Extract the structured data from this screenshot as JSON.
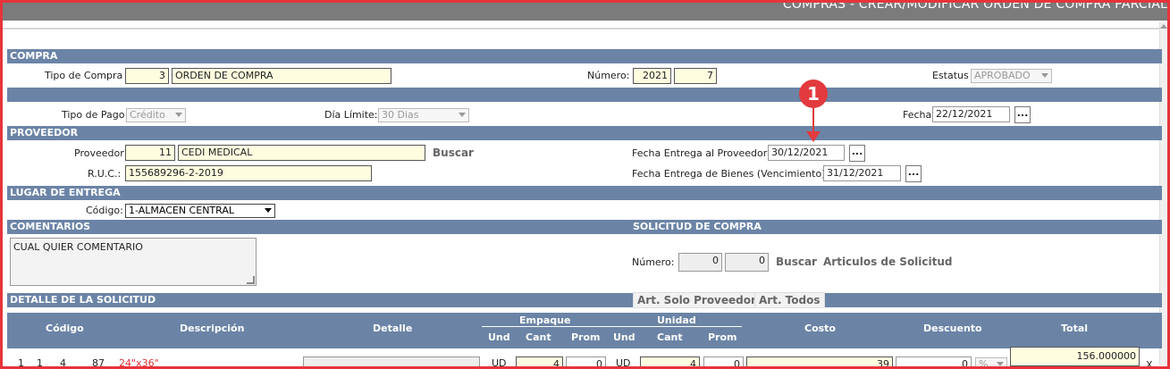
{
  "window": {
    "title": "COMPRAS - CREAR/MODIFICAR ORDEN DE COMPRA PARCIAL"
  },
  "compra": {
    "section": "COMPRA",
    "tipo_label": "Tipo de Compra",
    "tipo_code": "3",
    "tipo_name": "ORDEN DE COMPRA",
    "numero_label": "Número:",
    "numero_year": "2021",
    "numero_seq": "7",
    "estatus_label": "Estatus",
    "estatus_value": "APROBADO"
  },
  "pago": {
    "tipo_pago_label": "Tipo de Pago",
    "tipo_pago_value": "Crédito",
    "dia_limite_label": "Día Límite:",
    "dia_limite_value": "30 Dias",
    "fecha_label": "Fecha",
    "fecha_value": "22/12/2021",
    "dots": "..."
  },
  "proveedor": {
    "section": "PROVEEDOR",
    "proveedor_label": "Proveedor",
    "code": "11",
    "name": "CEDI MEDICAL",
    "buscar": "Buscar",
    "ruc_label": "R.U.C.:",
    "ruc_value": "155689296-2-2019",
    "fecha_entrega_label": "Fecha Entrega al Proveedor",
    "fecha_entrega_value": "30/12/2021",
    "fecha_bienes_label": "Fecha Entrega de Bienes (Vencimiento)",
    "fecha_bienes_value": "31/12/2021",
    "dots": "..."
  },
  "lugar": {
    "section": "LUGAR DE ENTREGA",
    "codigo_label": "Código:",
    "codigo_value": "1-ALMACEN CENTRAL"
  },
  "comentarios": {
    "section": "COMENTARIOS",
    "text": "CUAL QUIER COMENTARIO"
  },
  "solicitud": {
    "section": "SOLICITUD DE COMPRA",
    "numero_label": "Número:",
    "num1": "0",
    "num2": "0",
    "buscar": "Buscar",
    "articulos": "Articulos de Solicitud"
  },
  "detalle": {
    "section": "DETALLE DE LA SOLICITUD",
    "btn_solo_proveedor": "Art. Solo Proveedor",
    "btn_todos": "Art. Todos",
    "headers": {
      "codigo": "Código",
      "descripcion": "Descripción",
      "detalle": "Detalle",
      "empaque": "Empaque",
      "unidad": "Unidad",
      "costo": "Costo",
      "descuento": "Descuento",
      "total": "Total",
      "und1": "Und",
      "cant1": "Cant",
      "prom1": "Prom",
      "und2": "Und",
      "cant2": "Cant",
      "prom2": "Prom"
    },
    "row": {
      "c1": "1",
      "c2": "1",
      "c3": "4",
      "c4": "87",
      "desc": "24\"x36\"",
      "und1": "UD",
      "cant1": "4",
      "prom1": "0",
      "und2": "UD",
      "cant2": "4",
      "prom2": "0",
      "costo": "39",
      "descuento": "0",
      "desc_type": "%",
      "total": "156.000000",
      "remove": "X"
    }
  },
  "annotation": {
    "callout": "1"
  },
  "colors": {
    "section_bar": "#6b84a6",
    "highlight_input": "#fffde0",
    "frame": "#e8333a",
    "callout": "#e23a3e"
  }
}
